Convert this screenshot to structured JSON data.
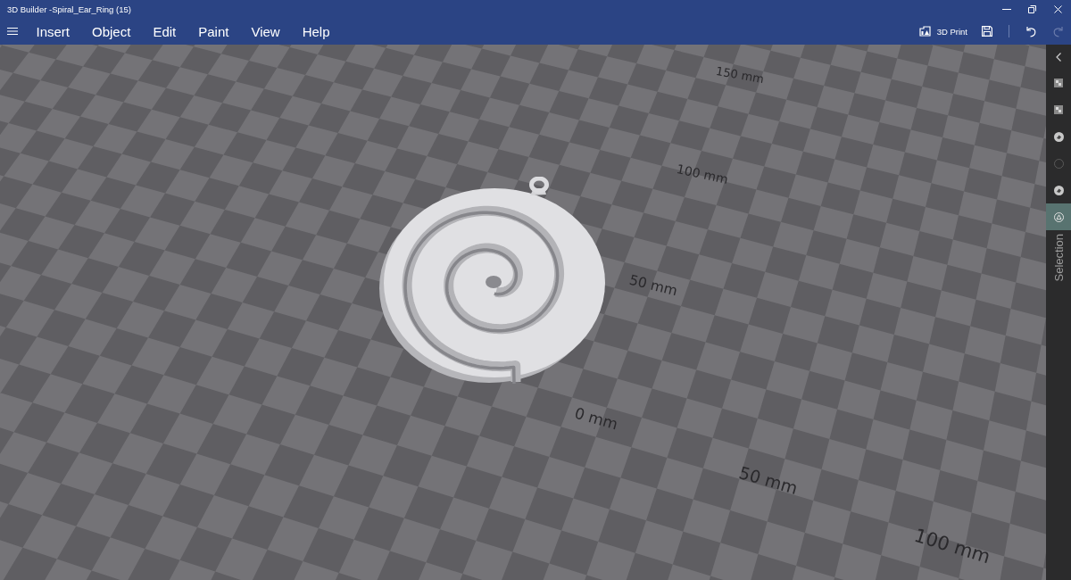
{
  "window": {
    "title": "3D Builder -Spiral_Ear_Ring (15)"
  },
  "menu_bar": {
    "items": [
      "Insert",
      "Object",
      "Edit",
      "Paint",
      "View",
      "Help"
    ]
  },
  "toolbar": [
    {
      "kind": "print",
      "label": "3D Print",
      "disabled": false
    },
    {
      "kind": "save",
      "disabled": false
    },
    {
      "kind": "undo",
      "disabled": false
    },
    {
      "kind": "redo",
      "disabled": true
    }
  ],
  "viewport": {
    "ruler_labels": [
      "150 mm",
      "100 mm",
      "50 mm",
      "0 mm",
      "50 mm",
      "100 mm"
    ]
  },
  "side_panel": {
    "title": "Selection",
    "tools": [
      {
        "kind": "square",
        "selected": false
      },
      {
        "kind": "square",
        "selected": false
      },
      {
        "kind": "badge",
        "selected": false
      },
      {
        "kind": "ring",
        "selected": false
      },
      {
        "kind": "badge",
        "selected": false
      },
      {
        "kind": "triangle",
        "selected": true
      }
    ]
  }
}
